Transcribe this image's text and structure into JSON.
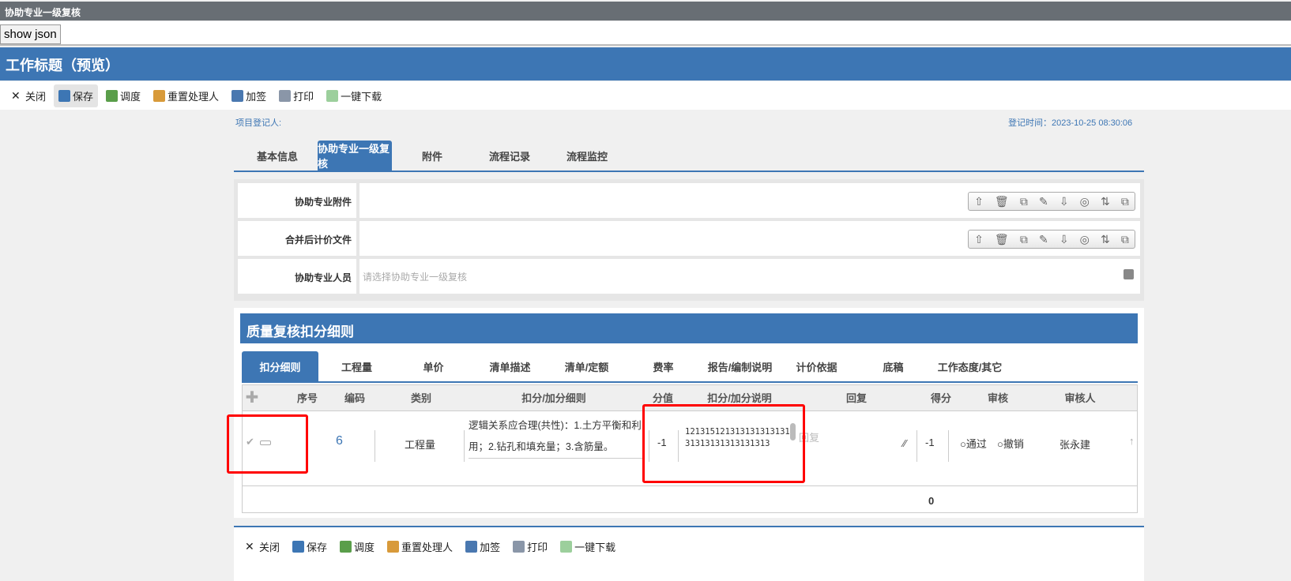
{
  "window_title": "协助专业一级复核",
  "show_json": "show json",
  "header_title": "工作标题（预览）",
  "toolbar": [
    {
      "label": "关闭",
      "icon": "close-icon"
    },
    {
      "label": "保存",
      "icon": "save-icon"
    },
    {
      "label": "调度",
      "icon": "dispatch-icon"
    },
    {
      "label": "重置处理人",
      "icon": "reset-handler-icon"
    },
    {
      "label": "加签",
      "icon": "add-sign-icon"
    },
    {
      "label": "打印",
      "icon": "print-icon"
    },
    {
      "label": "一键下载",
      "icon": "download-icon"
    }
  ],
  "meta": {
    "registrant": "项目登记人:",
    "reg_time": "登记时间：2023-10-25 08:30:06"
  },
  "tabs": [
    "基本信息",
    "协助专业一级复核",
    "附件",
    "流程记录",
    "流程监控"
  ],
  "form": {
    "rows": [
      {
        "label": "协助专业附件"
      },
      {
        "label": "合并后计价文件"
      },
      {
        "label": "协助专业人员",
        "placeholder": "请选择协助专业一级复核"
      }
    ]
  },
  "section": {
    "title": "质量复核扣分细则",
    "subtabs": [
      "扣分细则",
      "工程量",
      "单价",
      "清单描述",
      "清单/定额",
      "费率",
      "报告/编制说明",
      "计价依据",
      "底稿",
      "工作态度/其它"
    ],
    "columns": [
      "序号",
      "编码",
      "类别",
      "扣分/加分细则",
      "分值",
      "扣分/加分说明",
      "回复",
      "得分",
      "审核",
      "审核人"
    ],
    "row": {
      "code": "6",
      "category": "工程量",
      "rule": "逻辑关系应合理(共性)：1.土方平衡和利用；2.钻孔和填充量；3.含筋量。",
      "value": "-1",
      "explanation": "12131512131313131313131313131313131313",
      "reply_placeholder": "回复",
      "score": "-1",
      "pass": "通过",
      "revoke": "撤销",
      "reviewer": "张永建"
    },
    "total": "0"
  },
  "colors": {
    "accent": "#3d76b4",
    "titlebar": "#686e74"
  }
}
